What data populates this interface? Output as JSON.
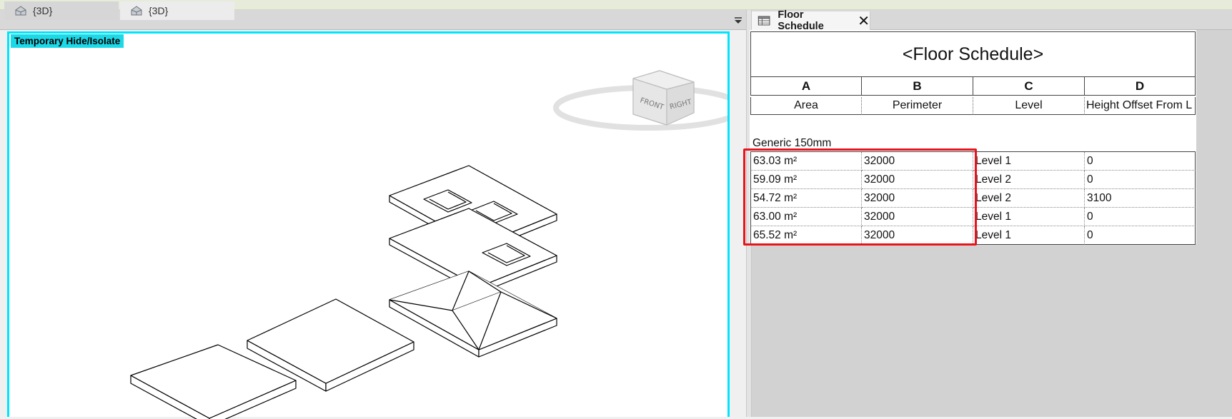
{
  "left_tabs": [
    {
      "label": "{3D}",
      "icon": "house-3d-icon"
    },
    {
      "label": "{3D}",
      "icon": "house-3d-icon"
    }
  ],
  "view": {
    "temporary_mode_label": "Temporary Hide/Isolate",
    "border_color": "#00e5ff",
    "viewcube": {
      "front_label": "FRONT",
      "right_label": "RIGHT"
    }
  },
  "schedule_tab": {
    "label": "Floor Schedule",
    "close_glyph": "✕",
    "icon": "schedule-table-icon"
  },
  "schedule": {
    "title": "<Floor Schedule>",
    "column_letters": [
      "A",
      "B",
      "C",
      "D"
    ],
    "column_names": [
      "Area",
      "Perimeter",
      "Level",
      "Height Offset From L"
    ],
    "group_label": "Generic 150mm",
    "rows": [
      [
        "63.03 m²",
        "32000",
        "Level 1",
        "0"
      ],
      [
        "59.09 m²",
        "32000",
        "Level 2",
        "0"
      ],
      [
        "54.72 m²",
        "32000",
        "Level 2",
        "3100"
      ],
      [
        "63.00 m²",
        "32000",
        "Level 1",
        "0"
      ],
      [
        "65.52 m²",
        "32000",
        "Level 1",
        "0"
      ]
    ],
    "highlight_color": "#e8141b"
  }
}
